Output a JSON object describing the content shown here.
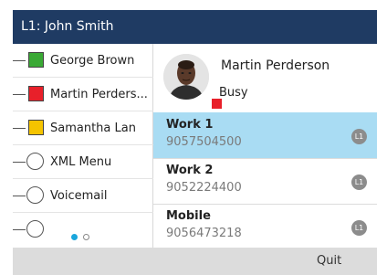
{
  "header": {
    "title": "L1: John Smith"
  },
  "line_keys": [
    {
      "label": "George Brown",
      "kind": "square",
      "color": "#3aa935"
    },
    {
      "label": "Martin Perders...",
      "kind": "square",
      "color": "#e8202a"
    },
    {
      "label": "Samantha Lan",
      "kind": "square",
      "color": "#f5c400"
    },
    {
      "label": "XML Menu",
      "kind": "circle"
    },
    {
      "label": "Voicemail",
      "kind": "circle"
    },
    {
      "label": "",
      "kind": "circle"
    }
  ],
  "pagination": {
    "current_page": 1,
    "total_pages": 2
  },
  "contact": {
    "name": "Martin Perderson",
    "status": "Busy",
    "status_color": "#e8202a",
    "avatar_icon": "person-photo"
  },
  "numbers": [
    {
      "type": "Work 1",
      "number": "9057504500",
      "line": "L1",
      "selected": true
    },
    {
      "type": "Work 2",
      "number": "9052224400",
      "line": "L1",
      "selected": false
    },
    {
      "type": "Mobile",
      "number": "9056473218",
      "line": "L1",
      "selected": false
    }
  ],
  "softkeys": {
    "quit_label": "Quit"
  }
}
